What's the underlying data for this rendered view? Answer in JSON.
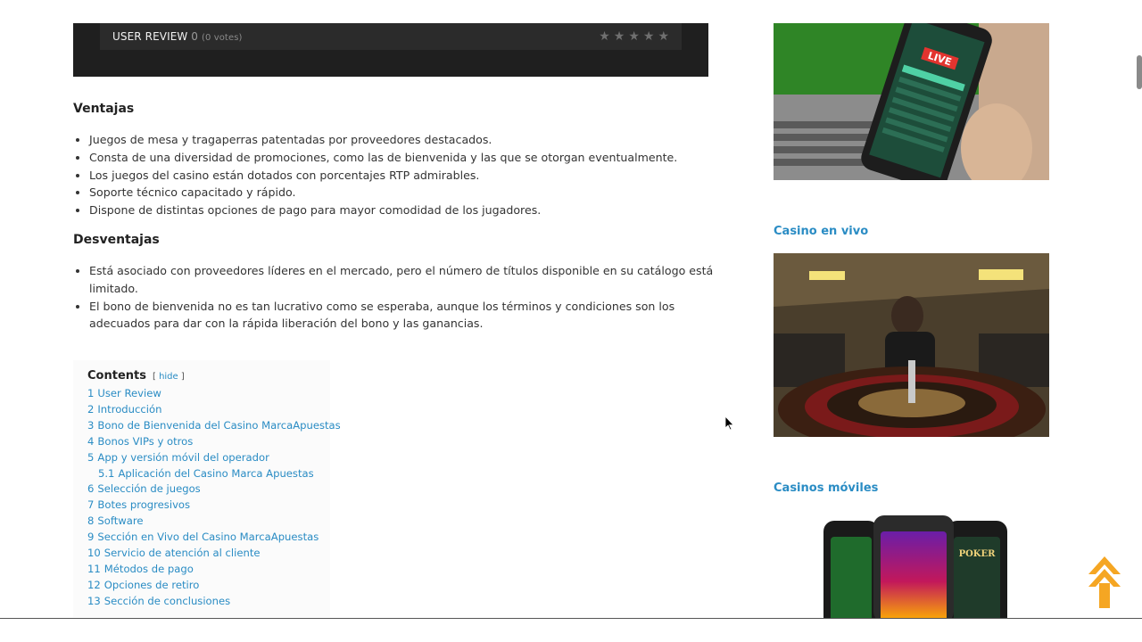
{
  "review": {
    "label": "USER REVIEW",
    "score": "0",
    "votes": "(0 votes)",
    "stars": [
      "★",
      "★",
      "★",
      "★",
      "★"
    ]
  },
  "ventajas": {
    "title": "Ventajas",
    "items": [
      "Juegos de mesa y tragaperras patentadas por proveedores destacados.",
      "Consta de una diversidad de promociones, como las de bienvenida y las que se otorgan eventualmente.",
      "Los juegos del casino están dotados con porcentajes RTP admirables.",
      "Soporte técnico capacitado y rápido.",
      "Dispone de distintas opciones de pago para mayor comodidad de los jugadores."
    ]
  },
  "desventajas": {
    "title": "Desventajas",
    "items": [
      "Está asociado con proveedores líderes en el mercado, pero el número de títulos disponible en su catálogo está limitado.",
      "El bono de bienvenida no es tan lucrativo como se esperaba, aunque los términos y condiciones son los adecuados para dar con la rápida liberación del bono y las ganancias."
    ]
  },
  "toc": {
    "title": "Contents",
    "toggle_open": "[",
    "toggle_label": "hide",
    "toggle_close": "]",
    "items": [
      {
        "num": "1",
        "label": "User Review"
      },
      {
        "num": "2",
        "label": "Introducción"
      },
      {
        "num": "3",
        "label": "Bono de Bienvenida del Casino MarcaApuestas"
      },
      {
        "num": "4",
        "label": "Bonos VIPs y otros"
      },
      {
        "num": "5",
        "label": "App y versión móvil del operador"
      },
      {
        "num": "5.1",
        "label": "Aplicación del Casino Marca Apuestas"
      },
      {
        "num": "6",
        "label": "Selección de juegos"
      },
      {
        "num": "7",
        "label": "Botes progresivos"
      },
      {
        "num": "8",
        "label": "Software"
      },
      {
        "num": "9",
        "label": "Sección en Vivo del Casino MarcaApuestas"
      },
      {
        "num": "10",
        "label": "Servicio de atención al cliente"
      },
      {
        "num": "11",
        "label": "Métodos de pago"
      },
      {
        "num": "12",
        "label": "Opciones de retiro"
      },
      {
        "num": "13",
        "label": "Sección de conclusiones"
      }
    ]
  },
  "sidebar": {
    "live_badge": "LIVE",
    "section1_title": "Casino en vivo",
    "section2_title": "Casinos móviles",
    "poker_label": "POKER"
  },
  "colors": {
    "link": "#2a8cc4",
    "accent_arrow": "#f5a623",
    "review_bg": "#1f1f1f"
  }
}
